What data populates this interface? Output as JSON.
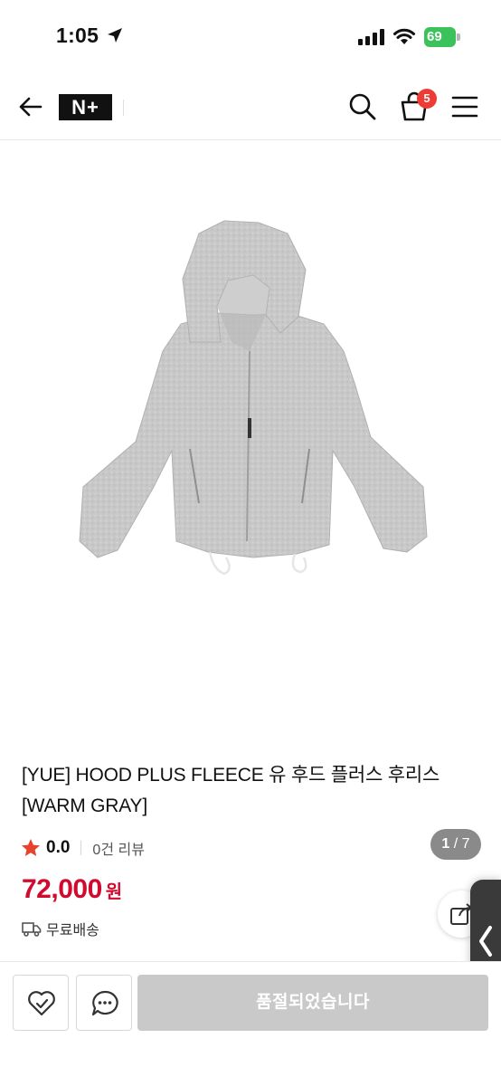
{
  "status_bar": {
    "time": "1:05",
    "battery": "69",
    "icons": [
      "location-arrow-icon",
      "signal-icon",
      "wifi-icon",
      "battery-icon"
    ]
  },
  "header": {
    "logo": "N+",
    "cart_count": "5",
    "icons": [
      "back-arrow-icon",
      "search-icon",
      "cart-icon",
      "menu-icon"
    ]
  },
  "gallery": {
    "current": "1",
    "separator": " / ",
    "total": "7"
  },
  "product": {
    "title": "[YUE] HOOD PLUS FLEECE 유 후드 플러스 후리스 [WARM GRAY]",
    "rating": "0.0",
    "review_count": "0건 리뷰",
    "price": "72,000",
    "currency": "원",
    "shipping": "무료배송"
  },
  "actions": {
    "soldout_label": "품절되었습니다",
    "icons": [
      "wishlist-icon",
      "chat-icon",
      "share-icon"
    ]
  },
  "colors": {
    "price": "#d10a2f",
    "badge": "#ee3b33",
    "battery": "#3cc25a",
    "soldout": "#c9c9c9",
    "star": "#e8412c"
  }
}
